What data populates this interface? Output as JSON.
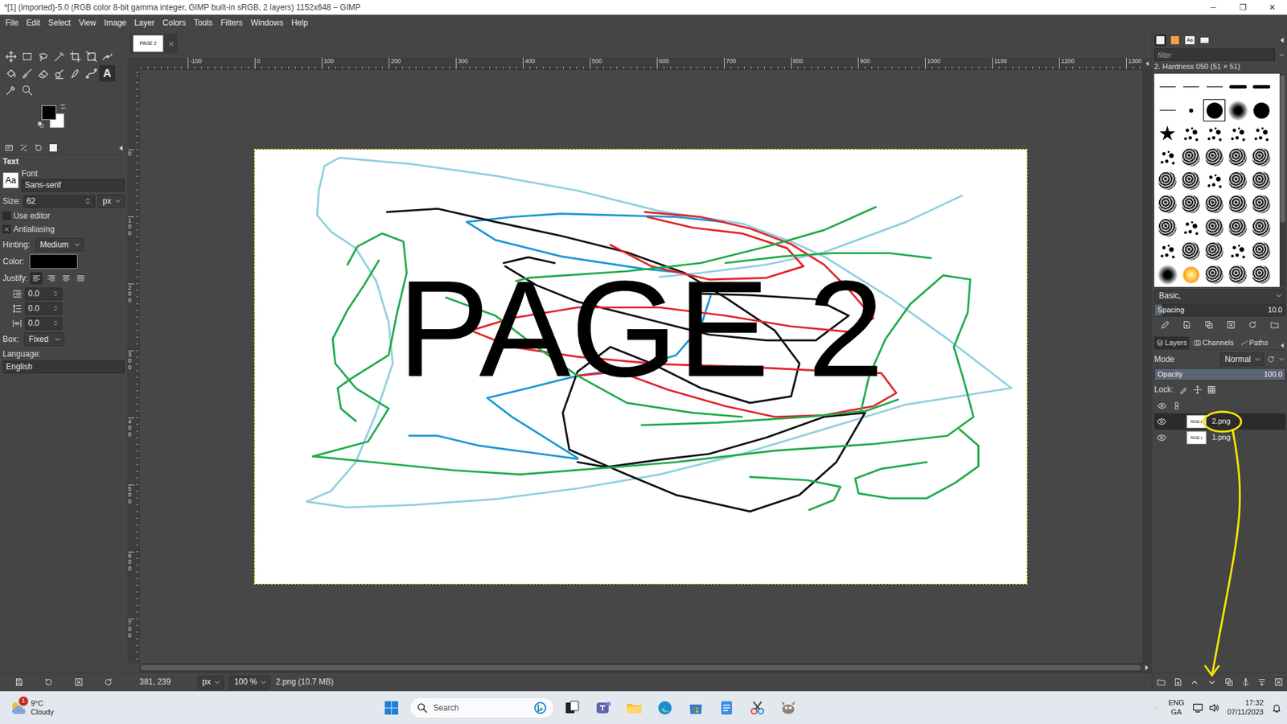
{
  "window": {
    "title": "*[1] (imported)-5.0 (RGB color 8-bit gamma integer, GIMP built-in sRGB, 2 layers) 1152x648 – GIMP",
    "controls": [
      "─",
      "❐",
      "✕"
    ]
  },
  "menu": [
    "File",
    "Edit",
    "Select",
    "View",
    "Image",
    "Layer",
    "Colors",
    "Tools",
    "Filters",
    "Windows",
    "Help"
  ],
  "tools": [
    {
      "selected": false
    },
    {
      "selected": false
    },
    {
      "selected": false
    },
    {
      "selected": false
    },
    {
      "selected": false
    },
    {
      "selected": false
    },
    {
      "selected": false
    },
    {
      "selected": false
    },
    {
      "selected": false
    },
    {
      "selected": false
    },
    {
      "selected": false
    },
    {
      "selected": false
    },
    {
      "selected": false
    },
    {
      "selected": true,
      "glyph": "A"
    },
    {
      "selected": false
    },
    {
      "selected": false
    }
  ],
  "colors": {
    "foreground": "#000000",
    "background": "#ffffff"
  },
  "tool_options": {
    "title": "Text",
    "font_label": "Font",
    "font_preview": "Aa",
    "font": "Sans-serif",
    "size_label": "Size:",
    "size": "62",
    "size_unit": "px",
    "checks": [
      {
        "label": "Use editor",
        "checked": false
      },
      {
        "label": "Antialiasing",
        "checked": true
      }
    ],
    "hinting_label": "Hinting:",
    "hinting": "Medium",
    "color_label": "Color:",
    "color": "#000000",
    "justify_label": "Justify:",
    "justify": [
      {
        "selected": true
      },
      {
        "selected": false
      },
      {
        "selected": false
      },
      {
        "selected": false
      }
    ],
    "spacing": [
      "0.0",
      "0.0",
      "0.0"
    ],
    "box_label": "Box:",
    "box": "Fixed",
    "language_label": "Language:",
    "language": "English"
  },
  "image_tabs": [
    {
      "thumb": "PAGE 2",
      "selected": true
    }
  ],
  "rulers": {
    "horizontal": [
      "-100",
      "0",
      "100",
      "200",
      "300",
      "400",
      "500",
      "600",
      "700",
      "800",
      "900",
      "1000",
      "1100",
      "1200",
      "1300"
    ],
    "vertical": [
      "0",
      "100",
      "200",
      "300",
      "400",
      "500",
      "600",
      "700"
    ]
  },
  "image": {
    "text": "PAGE 2"
  },
  "status_bar": {
    "pointer": "381, 239",
    "unit": "px",
    "zoom": "100 %",
    "info": "2.png (10.7 MB)"
  },
  "dock_tabs": [
    {
      "kind": "brushes",
      "selected": true
    },
    {
      "kind": "patterns",
      "selected": false
    },
    {
      "kind": "fonts",
      "label": "Aa",
      "selected": false
    },
    {
      "kind": "documents",
      "selected": false
    }
  ],
  "brushes": {
    "filter_placeholder": "filter",
    "current": "2. Hardness 050 (51 × 51)",
    "items": [
      {
        "kind": "line",
        "selected": false
      },
      {
        "kind": "line",
        "selected": false
      },
      {
        "kind": "line",
        "selected": false
      },
      {
        "kind": "bar",
        "selected": false
      },
      {
        "kind": "bar",
        "selected": false
      },
      {
        "kind": "line",
        "selected": false
      },
      {
        "kind": "dot",
        "selected": false
      },
      {
        "kind": "hard",
        "selected": true
      },
      {
        "kind": "soft",
        "selected": false
      },
      {
        "kind": "hard",
        "selected": false
      },
      {
        "kind": "star",
        "selected": false
      },
      {
        "kind": "splatter",
        "selected": false
      },
      {
        "kind": "splatter",
        "selected": false
      },
      {
        "kind": "splatter",
        "selected": false
      },
      {
        "kind": "splatter",
        "selected": false
      },
      {
        "kind": "splatter",
        "selected": false
      },
      {
        "kind": "texture",
        "selected": false
      },
      {
        "kind": "texture",
        "selected": false
      },
      {
        "kind": "texture",
        "selected": false
      },
      {
        "kind": "texture",
        "selected": false
      },
      {
        "kind": "texture",
        "selected": false
      },
      {
        "kind": "texture",
        "selected": false
      },
      {
        "kind": "splatter",
        "selected": false
      },
      {
        "kind": "texture",
        "selected": false
      },
      {
        "kind": "texture",
        "selected": false
      },
      {
        "kind": "texture",
        "selected": false
      },
      {
        "kind": "texture",
        "selected": false
      },
      {
        "kind": "texture",
        "selected": false
      },
      {
        "kind": "texture",
        "selected": false
      },
      {
        "kind": "texture",
        "selected": false
      },
      {
        "kind": "texture",
        "selected": false
      },
      {
        "kind": "splatter",
        "selected": false
      },
      {
        "kind": "texture",
        "selected": false
      },
      {
        "kind": "texture",
        "selected": false
      },
      {
        "kind": "texture",
        "selected": false
      },
      {
        "kind": "splatter",
        "selected": false
      },
      {
        "kind": "texture",
        "selected": false
      },
      {
        "kind": "texture",
        "selected": false
      },
      {
        "kind": "splatter",
        "selected": false
      },
      {
        "kind": "texture",
        "selected": false
      },
      {
        "kind": "soft",
        "selected": false
      },
      {
        "kind": "glow",
        "selected": false
      },
      {
        "kind": "texture",
        "selected": false
      },
      {
        "kind": "texture",
        "selected": false
      },
      {
        "kind": "texture",
        "selected": false
      }
    ],
    "tag": "Basic,",
    "spacing_label": "Spacing",
    "spacing": "10.0",
    "spacing_level": 0.05
  },
  "layers_tabs": [
    {
      "label": "Layers",
      "selected": true
    },
    {
      "label": "Channels",
      "selected": false
    },
    {
      "label": "Paths",
      "selected": false
    }
  ],
  "layers": {
    "mode_label": "Mode",
    "mode": "Normal",
    "opacity_label": "Opacity",
    "opacity": "100.0",
    "opacity_level": 1,
    "lock_label": "Lock:",
    "items": [
      {
        "name": "2.png",
        "thumb": "PAGE 2",
        "visible": true,
        "selected": true
      },
      {
        "name": "1.png",
        "thumb": "PAGE 1",
        "visible": true,
        "selected": false
      }
    ]
  },
  "taskbar": {
    "weather": {
      "temp": "9°C",
      "desc": "Cloudy",
      "badge": "1"
    },
    "search": "Search",
    "tray": {
      "lang": "ENG",
      "layout": "GA",
      "time": "17:32",
      "date": "07/11/2023"
    }
  }
}
